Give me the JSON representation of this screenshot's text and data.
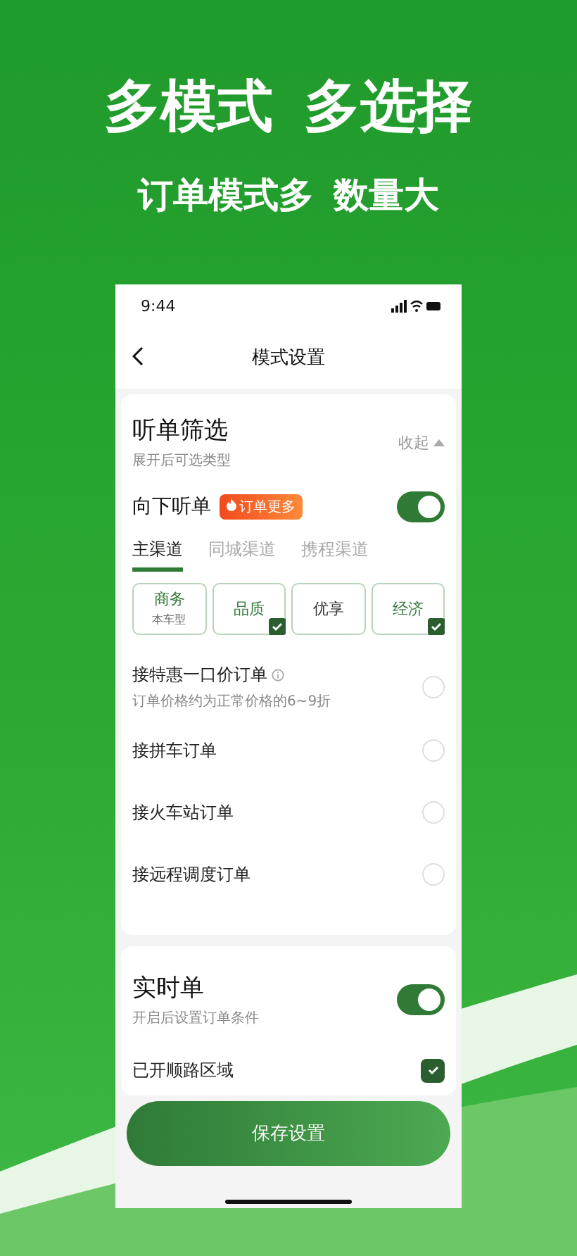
{
  "headline": [
    "多模式",
    "多选择"
  ],
  "subheadline": [
    "订单模式多",
    "数量大"
  ],
  "status_bar": {
    "time": "9:44"
  },
  "nav": {
    "title": "模式设置"
  },
  "filter": {
    "title": "听单筛选",
    "subtitle": "展开后可选类型",
    "collapse_label": "收起",
    "expanded": true
  },
  "listen": {
    "label": "向下听单",
    "badge": "订单更多",
    "on": true
  },
  "channel_tabs": [
    {
      "label": "主渠道",
      "selected": true
    },
    {
      "label": "同城渠道",
      "selected": false
    },
    {
      "label": "携程渠道",
      "selected": false
    }
  ],
  "car_types": [
    {
      "label": "商务",
      "sublabel": "本车型",
      "checked": false
    },
    {
      "label": "品质",
      "checked": true
    },
    {
      "label": "优享",
      "checked": false
    },
    {
      "label": "经济",
      "checked": true
    }
  ],
  "options": [
    {
      "label": "接特惠一口价订单",
      "hint": "订单价格约为正常价格的6~9折",
      "info": true,
      "checked": false
    },
    {
      "label": "接拼车订单",
      "checked": false
    },
    {
      "label": "接火车站订单",
      "checked": false
    },
    {
      "label": "接远程调度订单",
      "checked": false
    }
  ],
  "realtime": {
    "title": "实时单",
    "subtitle": "开启后设置订单条件",
    "on": true
  },
  "route": {
    "label": "已开顺路区域",
    "checked": true
  },
  "save_button": "保存设置"
}
